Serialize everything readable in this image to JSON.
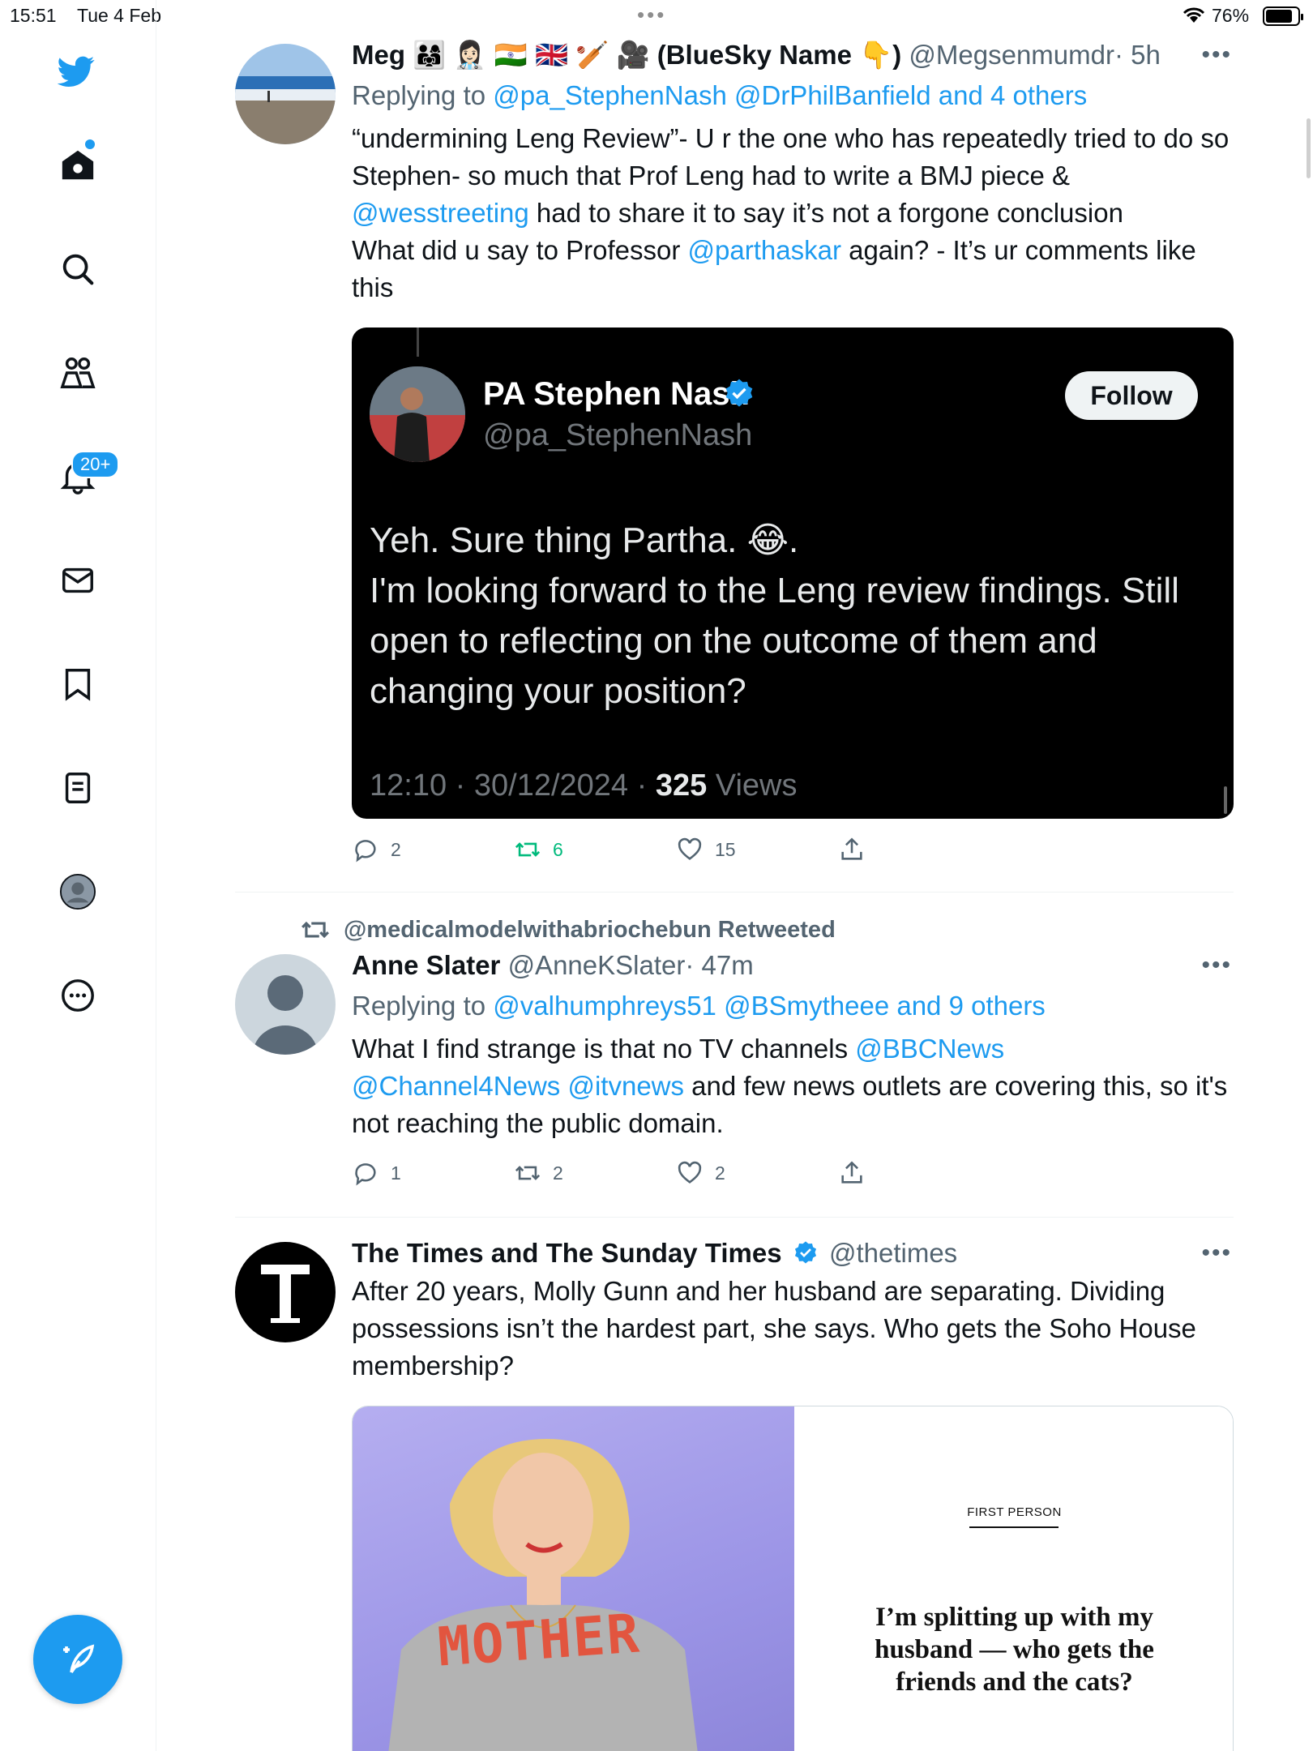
{
  "status": {
    "time": "15:51",
    "date": "Tue 4 Feb",
    "battery": "76%"
  },
  "sidebar": {
    "notifications_badge": "20+"
  },
  "tweets": [
    {
      "name": "Meg 👨‍👩‍👧 👩🏻‍⚕️ 🇮🇳 🇬🇧 🏏 🎥 (BlueSky Name 👇)",
      "handle": "@Megsenmumdr",
      "time": "· 5h",
      "reply_prefix": "Replying to",
      "reply_to": "@pa_StephenNash @DrPhilBanfield and 4 others",
      "text_1": "“undermining Leng Review”- U r the one who has repeatedly tried to do so Stephen- so much that Prof Leng had to write a BMJ piece & ",
      "mention_1": "@wesstreeting",
      "text_2": " had to share it to say it’s not a forgone conclusion",
      "text_3": "What did u say to Professor ",
      "mention_2": "@parthaskar",
      "text_4": " again? - It’s ur comments like this",
      "embed": {
        "name": "PA Stephen Nash",
        "handle": "@pa_StephenNash",
        "follow": "Follow",
        "text_1": "Yeh. Sure thing Partha. 😂.",
        "text_2": "I'm looking forward to the Leng review findings. Still open to reflecting on the outcome of them and changing your position?",
        "meta_time": "12:10 · 30/12/2024 · ",
        "views_count": "325",
        "views_label": " Views"
      },
      "replies": "2",
      "retweets": "6",
      "likes": "15"
    },
    {
      "retweeted_by": "@medicalmodelwithabriochebun Retweeted",
      "name": "Anne Slater",
      "handle": "@AnneKSlater",
      "time": "· 47m",
      "reply_prefix": "Replying to",
      "reply_to": "@valhumphreys51 @BSmytheee and 9 others",
      "text_1": "What I find strange is that no TV channels ",
      "mention_1": "@BBCNews",
      "mention_2": "@Channel4News",
      "mention_3": "@itvnews",
      "text_2": " and few news outlets are covering this, so it's not reaching the public domain.",
      "replies": "1",
      "retweets": "2",
      "likes": "2"
    },
    {
      "name": "The Times and The Sunday Times",
      "handle": "@thetimes",
      "text": "After 20 years, Molly Gunn and her husband are separating. Dividing possessions isn’t the hardest part, she says. Who gets the Soho House membership?",
      "card": {
        "kicker": "FIRST PERSON",
        "headline": "I’m splitting up with my husband — who gets the friends and the cats?",
        "sweater_text": "MOTHER"
      }
    }
  ],
  "colors": {
    "accent": "#1d9bf0",
    "retweet": "#00ba7c",
    "secondary": "#536471"
  },
  "icons": [
    "twitter-logo-icon",
    "home-icon",
    "search-icon",
    "communities-icon",
    "bell-icon",
    "mail-icon",
    "bookmark-icon",
    "lists-icon",
    "profile-icon",
    "more-icon",
    "compose-icon",
    "reply-icon",
    "retweet-icon",
    "like-icon",
    "share-icon",
    "verified-icon"
  ]
}
